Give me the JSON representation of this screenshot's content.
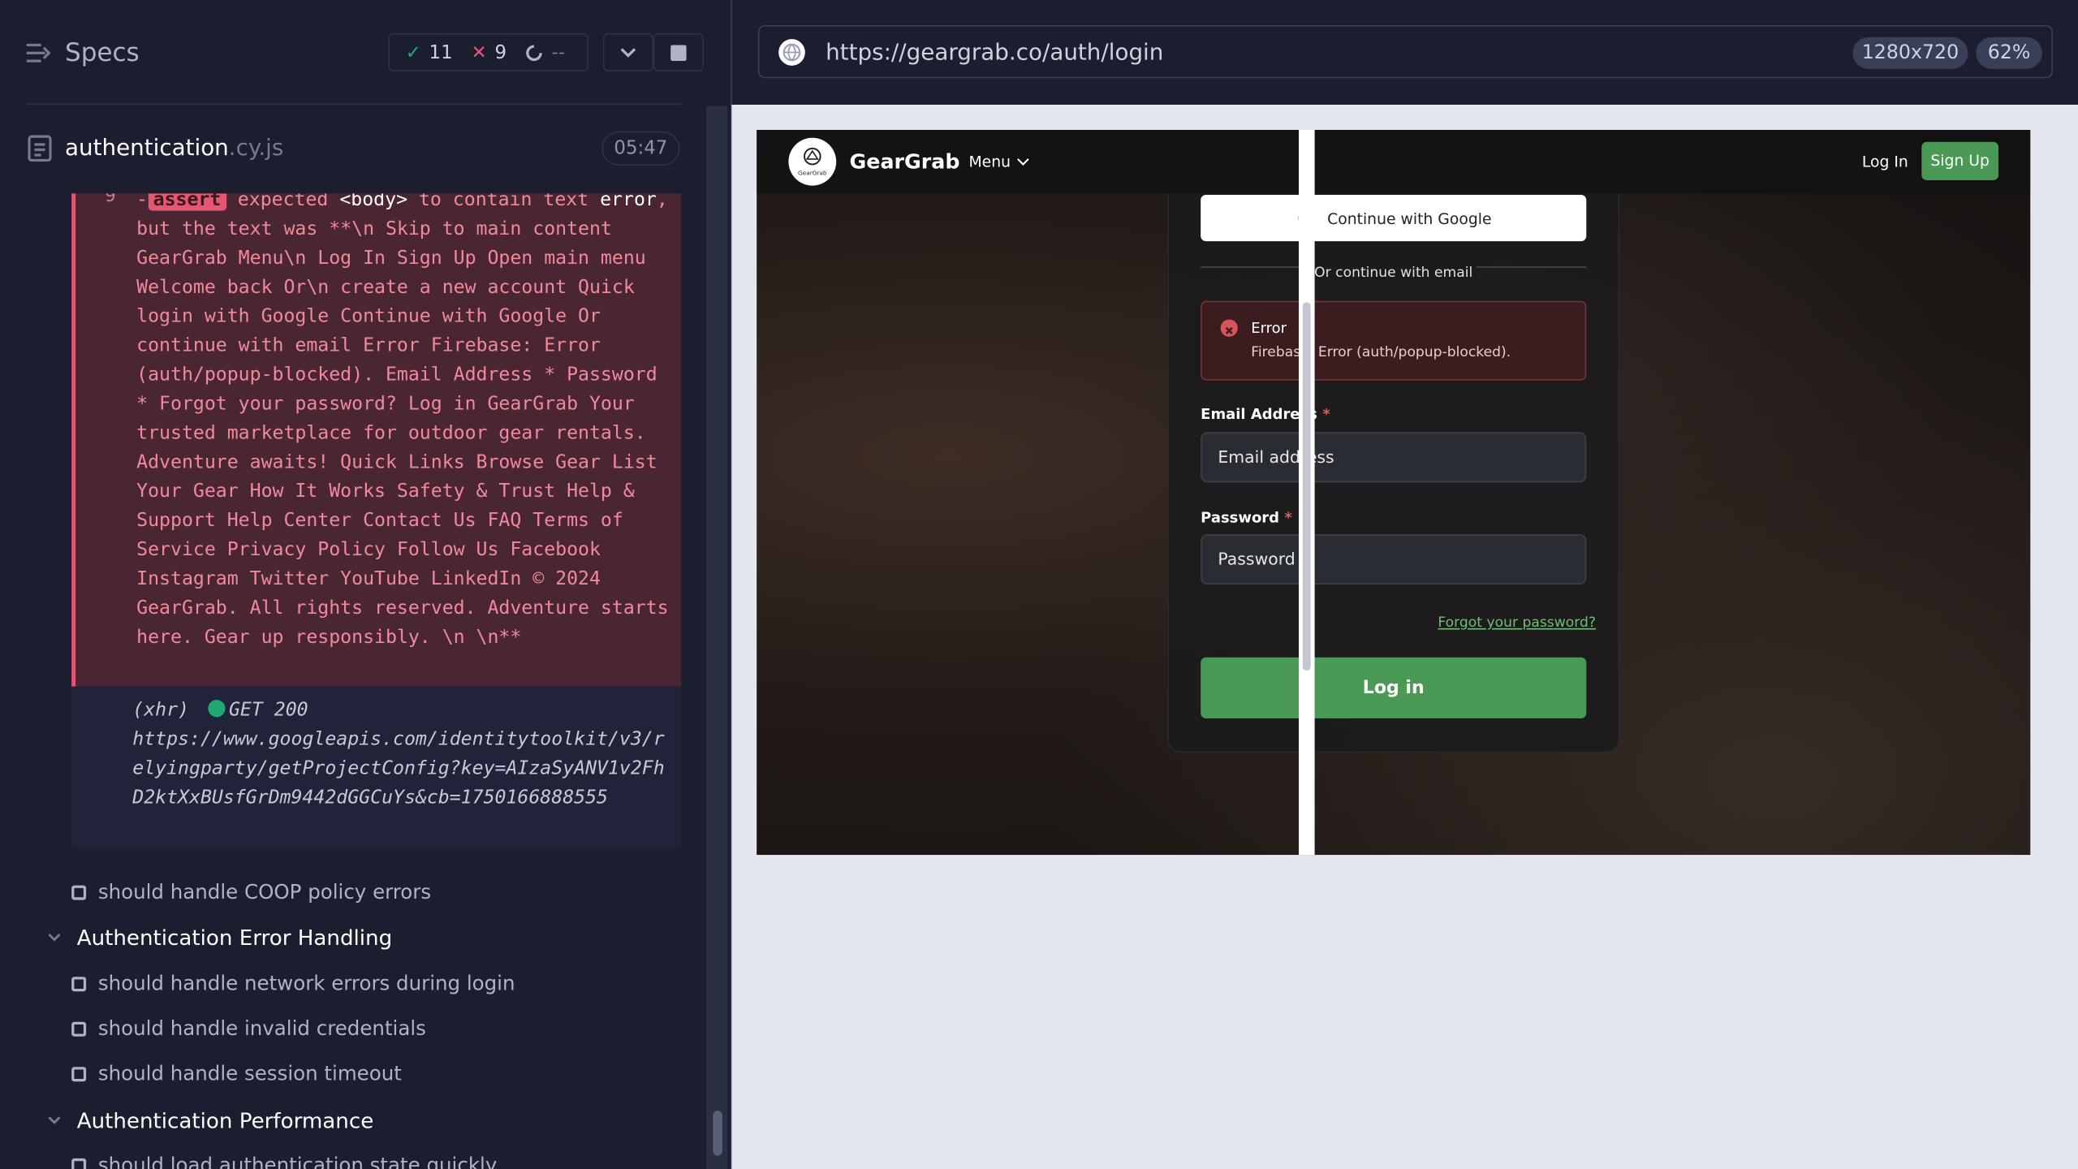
{
  "reporter": {
    "title": "Specs",
    "stats": {
      "passed": "11",
      "failed": "9",
      "pending": "--"
    },
    "file": {
      "name": "authentication",
      "ext": ".cy.js",
      "duration": "05:47"
    },
    "error": {
      "line_no": "9",
      "prefix": "-",
      "assert_label": "assert",
      "text_1": "expected",
      "body_tag": "<body>",
      "text_2": "to contain text",
      "expected": "error",
      "text_3": ", but the text was **\\n Skip to main content GearGrab Menu\\n Log In Sign Up Open main menu Welcome back Or\\n create a new account Quick login with Google Continue with Google Or continue with email Error Firebase: Error (auth/popup-blocked). Email Address * Password * Forgot your password? Log in GearGrab Your trusted marketplace for outdoor gear rentals. Adventure awaits! Quick Links Browse Gear List Your Gear How It Works Safety & Trust Help & Support Help Center Contact Us FAQ Terms of Service Privacy Policy Follow Us Facebook Instagram Twitter YouTube LinkedIn © 2024 GearGrab. All rights reserved. Adventure starts here. Gear up responsibly. \\n \\n**"
    },
    "xhr": {
      "label": "(xhr)",
      "method_status": "GET 200",
      "url": "https://www.googleapis.com/identitytoolkit/v3/relyingparty/getProjectConfig?key=AIzaSyANV1v2FhD2ktXxBUsfGrDm9442dGGCuYs&cb=1750166888555"
    },
    "tests": [
      {
        "kind": "test",
        "label": "should handle COOP policy errors"
      },
      {
        "kind": "suite",
        "label": "Authentication Error Handling"
      },
      {
        "kind": "test",
        "label": "should handle network errors during login"
      },
      {
        "kind": "test",
        "label": "should handle invalid credentials"
      },
      {
        "kind": "test",
        "label": "should handle session timeout"
      },
      {
        "kind": "suite",
        "label": "Authentication Performance"
      },
      {
        "kind": "test",
        "label": "should load authentication state quickly"
      }
    ]
  },
  "browser": {
    "url": "https://geargrab.co/auth/login",
    "viewport": "1280x720",
    "zoom": "62%"
  },
  "site": {
    "brand": "GearGrab",
    "logo_text": "GearGrab",
    "menu": "Menu",
    "login_link": "Log In",
    "signup_button": "Sign Up",
    "google_button": "Continue with Google",
    "divider_text": "Or continue with email",
    "error_title": "Error",
    "error_message": "Firebase: Error (auth/popup-blocked).",
    "email_label": "Email Address",
    "email_placeholder": "Email address",
    "password_label": "Password",
    "password_placeholder": "Password",
    "required_mark": "*",
    "forgot_link": "Forgot your password?",
    "submit_button": "Log in"
  },
  "colors": {
    "pass": "#1fa971",
    "fail": "#e45770",
    "brand_green": "#4a9a55"
  }
}
